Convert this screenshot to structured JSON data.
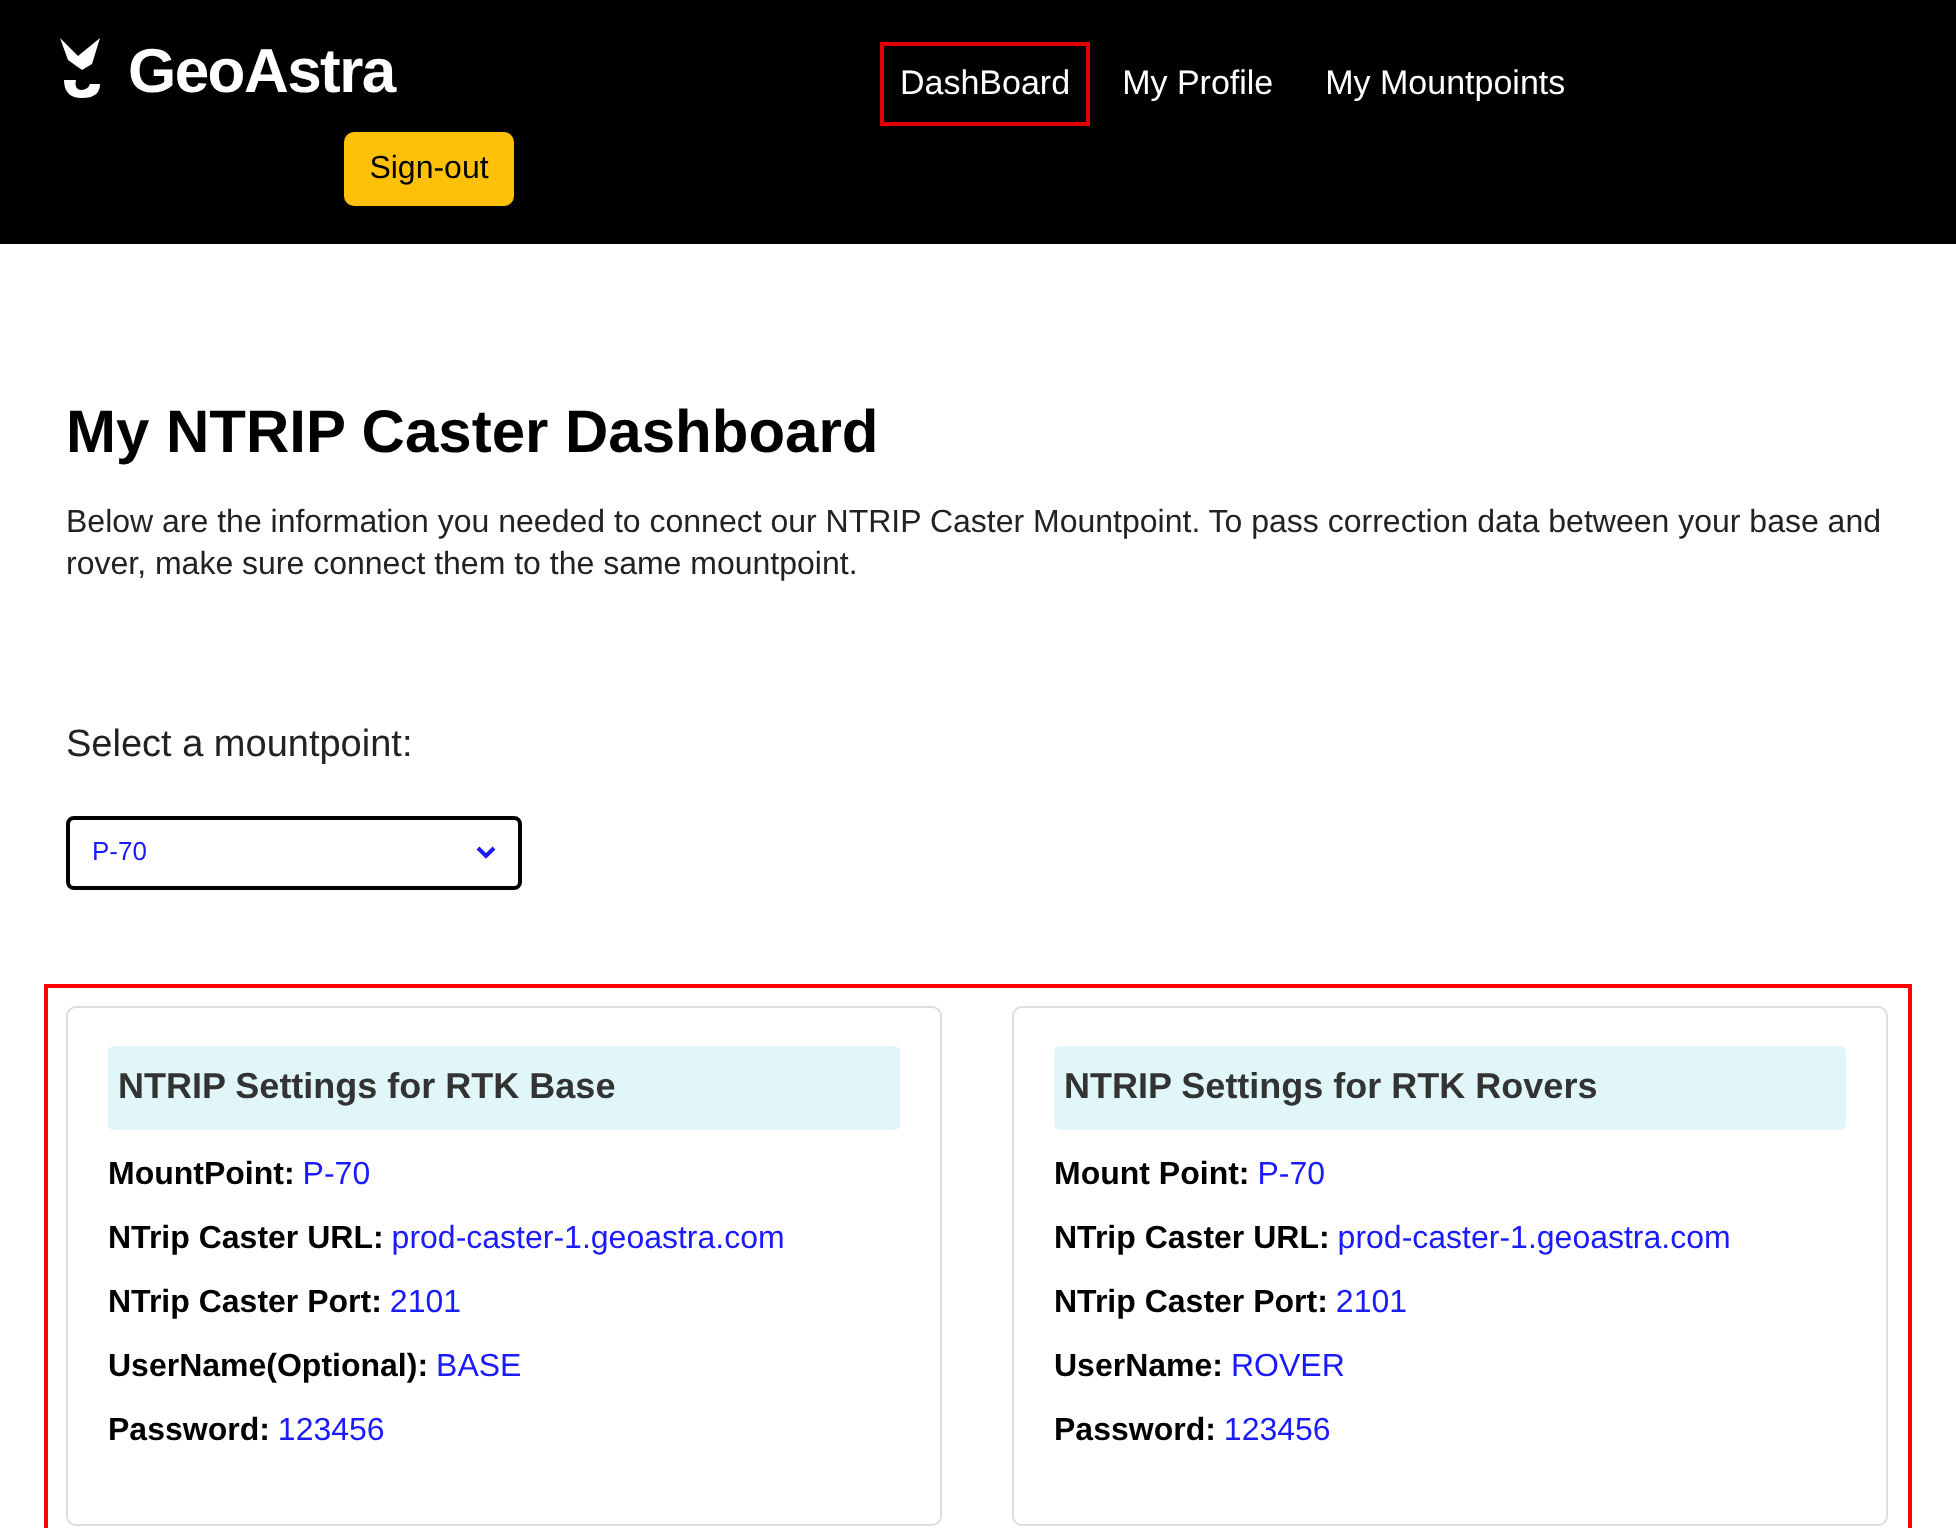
{
  "header": {
    "brand": "GeoAstra",
    "nav": [
      {
        "label": "DashBoard",
        "selected": true
      },
      {
        "label": "My Profile",
        "selected": false
      },
      {
        "label": "My Mountpoints",
        "selected": false
      }
    ],
    "sign_out": "Sign-out"
  },
  "title": "My NTRIP Caster Dashboard",
  "intro": "Below are the information you needed to connect our NTRIP Caster Mountpoint. To pass correction data between your base and rover, make sure connect them to the same mountpoint.",
  "mountpoint_select": {
    "label": "Select a mountpoint:",
    "value": "P-70"
  },
  "highlighted": true,
  "cards": [
    {
      "title": "NTRIP Settings for RTK Base",
      "fields": [
        {
          "label": "MountPoint:",
          "value": "P-70"
        },
        {
          "label": "NTrip Caster URL:",
          "value": "prod-caster-1.geoastra.com"
        },
        {
          "label": "NTrip Caster Port:",
          "value": "2101"
        },
        {
          "label": "UserName(Optional):",
          "value": "BASE"
        },
        {
          "label": "Password:",
          "value": "123456"
        }
      ]
    },
    {
      "title": "NTRIP Settings for RTK Rovers",
      "fields": [
        {
          "label": "Mount Point:",
          "value": "P-70"
        },
        {
          "label": "NTrip Caster URL:",
          "value": "prod-caster-1.geoastra.com"
        },
        {
          "label": "NTrip Caster Port:",
          "value": "2101"
        },
        {
          "label": "UserName:",
          "value": "ROVER"
        },
        {
          "label": "Password:",
          "value": "123456"
        }
      ]
    }
  ]
}
